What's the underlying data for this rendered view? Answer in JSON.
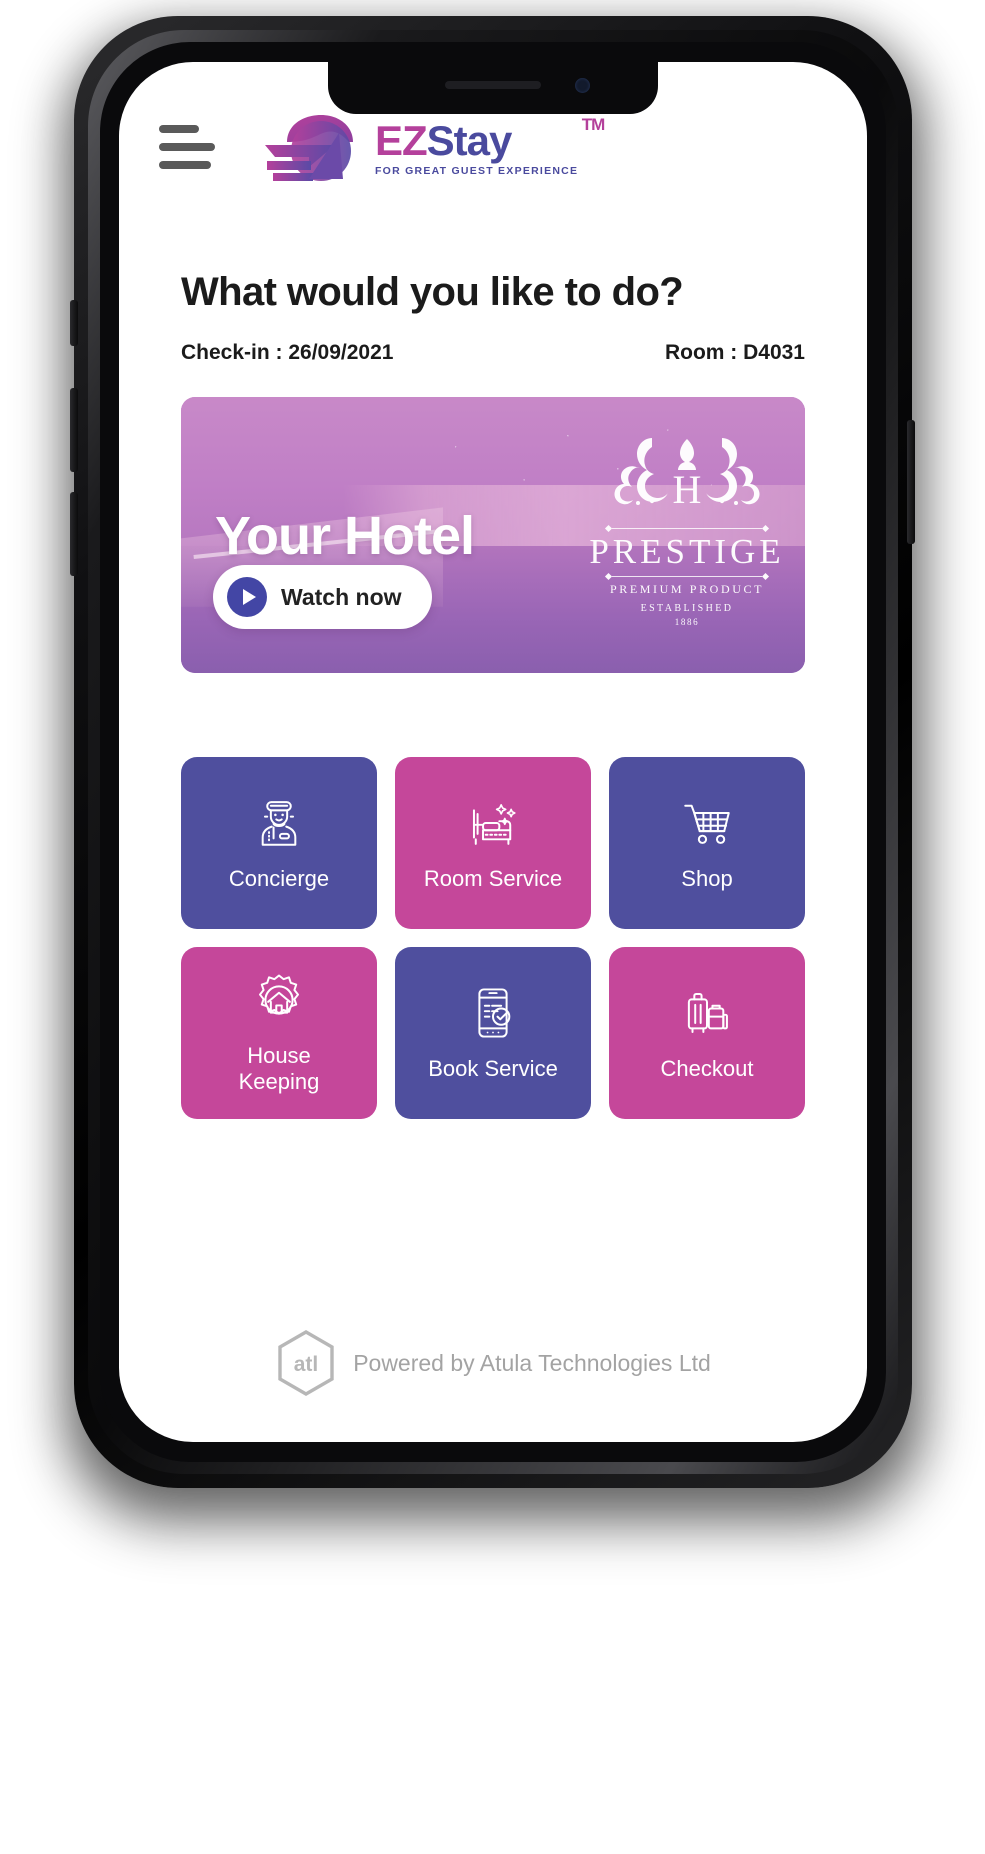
{
  "brand": {
    "word_a": "EZ",
    "word_b": "Stay",
    "tm": "TM",
    "tagline": "FOR GREAT GUEST EXPERIENCE",
    "mark_icon": "ez-arrow-logo-icon",
    "color_pink": "#b4409b",
    "color_purple": "#4a4a9e"
  },
  "appbar": {
    "menu_icon": "hamburger-menu-icon"
  },
  "page": {
    "headline": "What would you like to do?",
    "checkin_label": "Check-in : 26/09/2021",
    "room_label": "Room : D4031"
  },
  "hero": {
    "title": "Your Hotel",
    "watch_label": "Watch now",
    "play_icon": "play-icon",
    "emblem": {
      "monogram": "H",
      "name": "PRESTIGE",
      "sub": "PREMIUM PRODUCT",
      "established": "ESTABLISHED",
      "year": "1886",
      "crest_icon": "ornamental-crest-icon"
    }
  },
  "tiles": [
    {
      "label": "Concierge",
      "icon": "bellhop-icon",
      "color": "purple"
    },
    {
      "label": "Room Service",
      "icon": "bed-sparkle-icon",
      "color": "pink"
    },
    {
      "label": "Shop",
      "icon": "shopping-cart-icon",
      "color": "purple"
    },
    {
      "label": "House\nKeeping",
      "icon": "house-gear-icon",
      "color": "pink"
    },
    {
      "label": "Book Service",
      "icon": "mobile-check-icon",
      "color": "purple"
    },
    {
      "label": "Checkout",
      "icon": "luggage-icon",
      "color": "pink"
    }
  ],
  "footer": {
    "text": "Powered by Atula Technologies Ltd",
    "logo_icon": "atl-hexagon-logo-icon",
    "logo_text": "atl"
  },
  "colors": {
    "tile_purple": "#4f4f9e",
    "tile_pink": "#c5479a",
    "play_blue": "#4346a5"
  }
}
